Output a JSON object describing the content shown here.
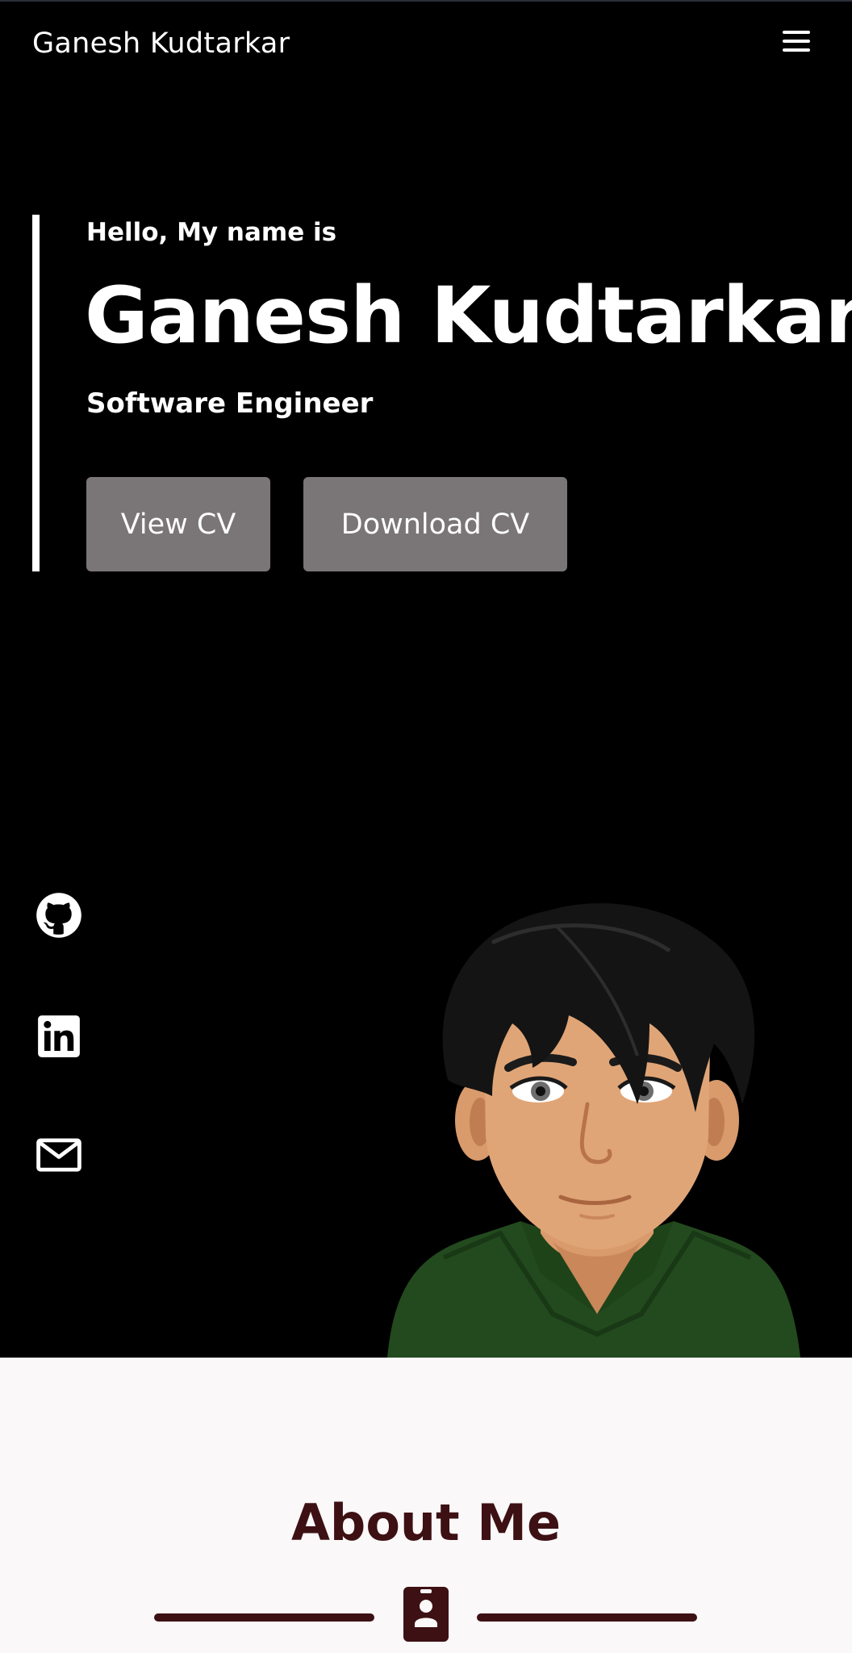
{
  "header": {
    "brand": "Ganesh Kudtarkar",
    "menu_icon": "hamburger-menu-icon"
  },
  "hero": {
    "greeting": "Hello, My name is",
    "name": "Ganesh Kudtarkar",
    "role": "Software Engineer",
    "buttons": {
      "view_cv": "View CV",
      "download_cv": "Download CV"
    }
  },
  "social": [
    {
      "icon": "github-icon"
    },
    {
      "icon": "linkedin-icon"
    },
    {
      "icon": "mail-icon"
    }
  ],
  "about": {
    "title": "About Me",
    "icon": "contact-card-icon"
  },
  "colors": {
    "background": "#000000",
    "button": "#7a7577",
    "accent": "#3d1014",
    "section_bg": "#faf8f8"
  }
}
